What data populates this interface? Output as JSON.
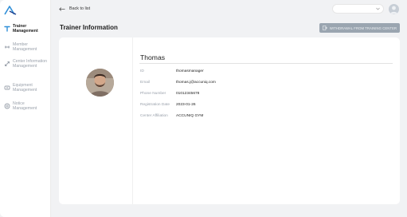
{
  "sidebar": {
    "items": [
      {
        "label": "Trainer Management",
        "icon": "trainer-icon",
        "active": true
      },
      {
        "label": "Member Management",
        "icon": "member-icon",
        "active": false
      },
      {
        "label": "Center Information Management",
        "icon": "center-icon",
        "active": false
      },
      {
        "label": "Equipment Management",
        "icon": "equipment-icon",
        "active": false
      },
      {
        "label": "Notice Management",
        "icon": "notice-icon",
        "active": false
      }
    ]
  },
  "topbar": {
    "back_label": "Back to list"
  },
  "header": {
    "title": "Trainer Information",
    "withdraw_label": "WITHDRAWAL FROM TRAINING CENTER"
  },
  "trainer": {
    "name": "Thomas",
    "fields": [
      {
        "label": "ID",
        "value": "thomasmanager"
      },
      {
        "label": "Email",
        "value": "thomas.j@accuniq.com"
      },
      {
        "label": "Phone Number",
        "value": "01012345678"
      },
      {
        "label": "Registration Date",
        "value": "2023-01-26"
      },
      {
        "label": "Center Affiliation",
        "value": "ACCUNIQ GYM"
      }
    ]
  },
  "colors": {
    "accent": "#2f8fd8",
    "button_bg": "#9aa5b0",
    "background": "#f1f2f4"
  }
}
